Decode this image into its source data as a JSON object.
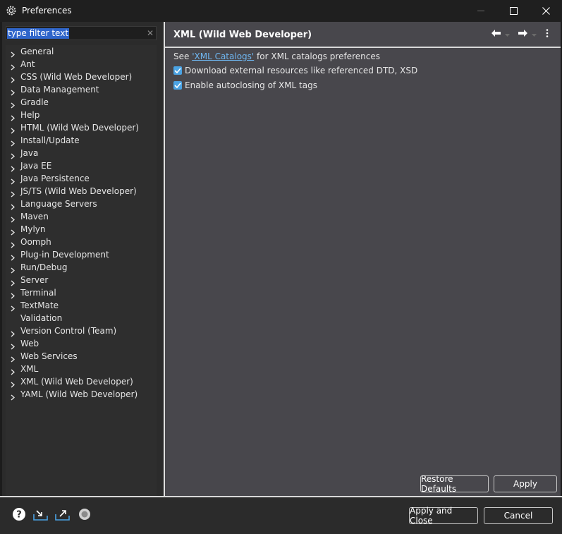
{
  "window": {
    "title": "Preferences",
    "icon": "gear-icon"
  },
  "filter": {
    "text": "type filter text",
    "clear_icon": "clear-icon"
  },
  "tree": {
    "items": [
      {
        "label": "General",
        "expandable": true
      },
      {
        "label": "Ant",
        "expandable": true
      },
      {
        "label": "CSS (Wild Web Developer)",
        "expandable": true
      },
      {
        "label": "Data Management",
        "expandable": true
      },
      {
        "label": "Gradle",
        "expandable": true
      },
      {
        "label": "Help",
        "expandable": true
      },
      {
        "label": "HTML (Wild Web Developer)",
        "expandable": true
      },
      {
        "label": "Install/Update",
        "expandable": true
      },
      {
        "label": "Java",
        "expandable": true
      },
      {
        "label": "Java EE",
        "expandable": true
      },
      {
        "label": "Java Persistence",
        "expandable": true
      },
      {
        "label": "JS/TS (Wild Web Developer)",
        "expandable": true
      },
      {
        "label": "Language Servers",
        "expandable": true
      },
      {
        "label": "Maven",
        "expandable": true
      },
      {
        "label": "Mylyn",
        "expandable": true
      },
      {
        "label": "Oomph",
        "expandable": true
      },
      {
        "label": "Plug-in Development",
        "expandable": true
      },
      {
        "label": "Run/Debug",
        "expandable": true
      },
      {
        "label": "Server",
        "expandable": true
      },
      {
        "label": "Terminal",
        "expandable": true
      },
      {
        "label": "TextMate",
        "expandable": true
      },
      {
        "label": "Validation",
        "expandable": false
      },
      {
        "label": "Version Control (Team)",
        "expandable": true
      },
      {
        "label": "Web",
        "expandable": true
      },
      {
        "label": "Web Services",
        "expandable": true
      },
      {
        "label": "XML",
        "expandable": true
      },
      {
        "label": "XML (Wild Web Developer)",
        "expandable": true
      },
      {
        "label": "YAML (Wild Web Developer)",
        "expandable": true
      }
    ]
  },
  "page": {
    "title": "XML (Wild Web Developer)",
    "desc_prefix": "See ",
    "desc_link": "'XML Catalogs'",
    "desc_suffix": " for XML catalogs preferences",
    "options": [
      {
        "label": "Download external resources like referenced DTD, XSD",
        "checked": true
      },
      {
        "label": "Enable autoclosing of XML tags",
        "checked": true
      }
    ],
    "restore_defaults": "Restore Defaults",
    "apply": "Apply"
  },
  "footer": {
    "apply_and_close": "Apply and Close",
    "cancel": "Cancel"
  },
  "colors": {
    "accent": "#4ba3e4",
    "link": "#6fb6f0",
    "selection": "#2f65ca"
  }
}
